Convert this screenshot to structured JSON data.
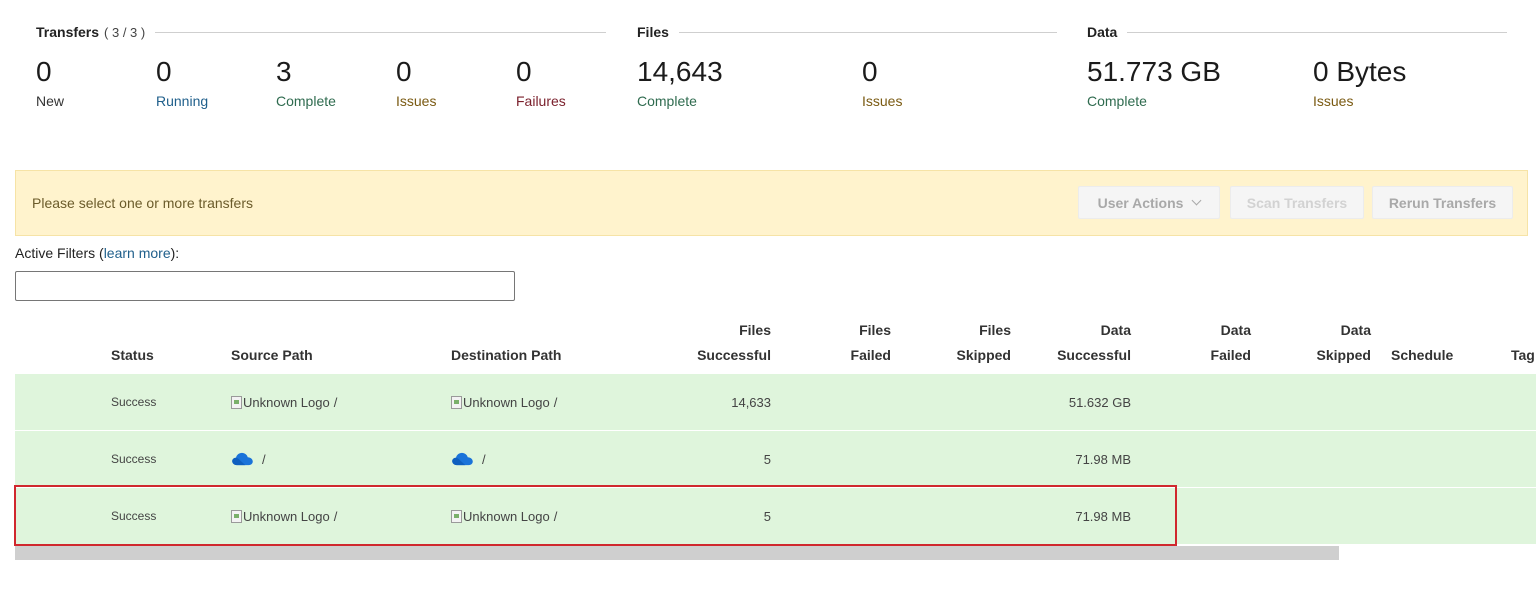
{
  "summary": {
    "transfers": {
      "title": "Transfers",
      "count": "( 3 / 3 )",
      "stats": [
        {
          "value": "0",
          "label": "New",
          "color": "#333333"
        },
        {
          "value": "0",
          "label": "Running",
          "color": "#1f5f8b"
        },
        {
          "value": "3",
          "label": "Complete",
          "color": "#2f6b4f"
        },
        {
          "value": "0",
          "label": "Issues",
          "color": "#7a5a12"
        },
        {
          "value": "0",
          "label": "Failures",
          "color": "#7a1f2b"
        }
      ]
    },
    "files": {
      "title": "Files",
      "stats": [
        {
          "value": "14,643",
          "label": "Complete",
          "color": "#2f6b4f"
        },
        {
          "value": "0",
          "label": "Issues",
          "color": "#7a5a12"
        }
      ]
    },
    "data": {
      "title": "Data",
      "stats": [
        {
          "value": "51.773 GB",
          "label": "Complete",
          "color": "#2f6b4f"
        },
        {
          "value": "0 Bytes",
          "label": "Issues",
          "color": "#7a5a12"
        }
      ]
    }
  },
  "action_bar": {
    "message": "Please select one or more transfers",
    "user_actions_label": "User Actions",
    "scan_label": "Scan Transfers",
    "rerun_label": "Rerun Transfers"
  },
  "filters": {
    "label": "Active Filters (",
    "link": "learn more",
    "label_end": "):",
    "value": ""
  },
  "table": {
    "headers": {
      "status": "Status",
      "source_path": "Source Path",
      "destination_path": "Destination Path",
      "files_successful": [
        "Files",
        "Successful"
      ],
      "files_failed": [
        "Files",
        "Failed"
      ],
      "files_skipped": [
        "Files",
        "Skipped"
      ],
      "data_successful": [
        "Data",
        "Successful"
      ],
      "data_failed": [
        "Data",
        "Failed"
      ],
      "data_skipped": [
        "Data",
        "Skipped"
      ],
      "schedule": "Schedule",
      "tags": "Tag"
    },
    "rows": [
      {
        "status": "Success",
        "source_logo": "Unknown Logo",
        "source_path": "/",
        "source_icon": "",
        "dest_logo": "Unknown Logo",
        "dest_path": "/",
        "dest_icon": "",
        "files_successful": "14,633",
        "files_failed": "",
        "files_skipped": "",
        "data_successful": "51.632 GB",
        "data_failed": "",
        "data_skipped": ""
      },
      {
        "status": "Success",
        "source_logo": "",
        "source_path": "/",
        "source_icon": "onedrive-cloud-icon",
        "dest_logo": "",
        "dest_path": "/",
        "dest_icon": "onedrive-cloud-icon",
        "files_successful": "5",
        "files_failed": "",
        "files_skipped": "",
        "data_successful": "71.98 MB",
        "data_failed": "",
        "data_skipped": ""
      },
      {
        "status": "Success",
        "source_logo": "Unknown Logo",
        "source_path": "/",
        "source_icon": "",
        "dest_logo": "Unknown Logo",
        "dest_path": "/",
        "dest_icon": "",
        "files_successful": "5",
        "files_failed": "",
        "files_skipped": "",
        "data_successful": "71.98 MB",
        "data_failed": "",
        "data_skipped": ""
      }
    ]
  },
  "colors": {
    "row_success_bg": "#dff5dc",
    "action_bar_bg": "#fff3cd",
    "highlight_border": "#d0282e",
    "link": "#1f5f8b"
  }
}
